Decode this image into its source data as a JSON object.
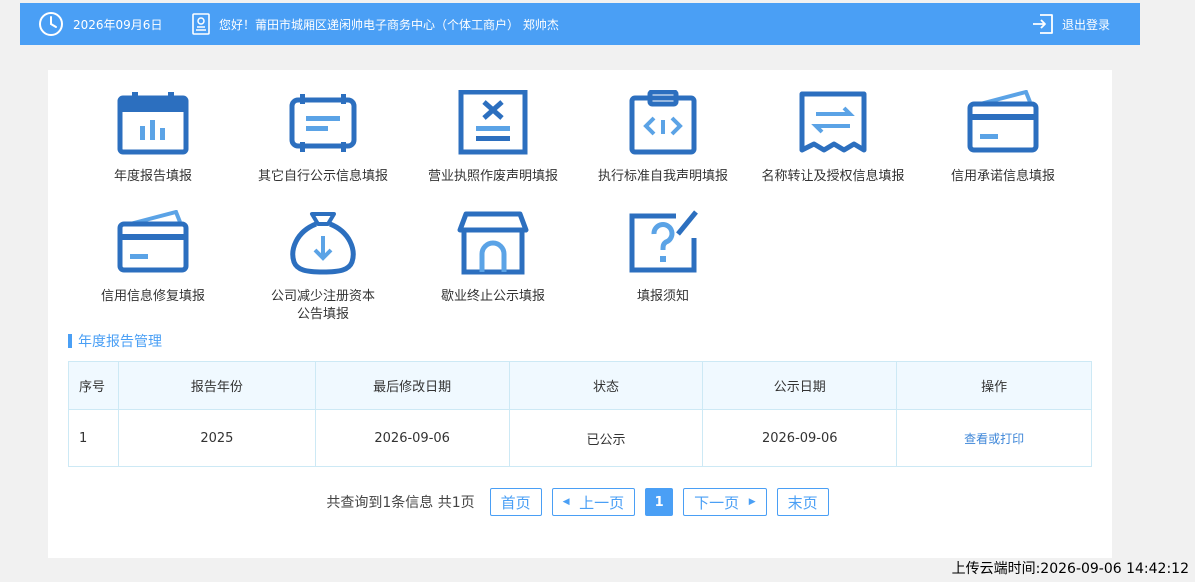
{
  "header": {
    "date": "2026年09月6日",
    "welcome": "您好！莆田市城厢区递闲帅电子商务中心（个体工商户） 郑帅杰",
    "logout": "退出登录"
  },
  "tiles": [
    {
      "label": "年度报告填报",
      "icon": "calendar-chart-icon"
    },
    {
      "label": "其它自行公示信息填报",
      "icon": "signboard-icon"
    },
    {
      "label": "营业执照作废声明填报",
      "icon": "license-void-icon"
    },
    {
      "label": "执行标准自我声明填报",
      "icon": "clipboard-code-icon"
    },
    {
      "label": "名称转让及授权信息填报",
      "icon": "transfer-receipt-icon"
    },
    {
      "label": "信用承诺信息填报",
      "icon": "credit-card-icon"
    },
    {
      "label": "信用信息修复填报",
      "icon": "credit-card-icon"
    },
    {
      "label": "公司减少注册资本",
      "label2": "公告填报",
      "icon": "money-bag-down-icon"
    },
    {
      "label": "歇业终止公示填报",
      "icon": "store-icon"
    },
    {
      "label": "填报须知",
      "icon": "question-edit-icon"
    }
  ],
  "section": {
    "title": "年度报告管理"
  },
  "table": {
    "headers": [
      "序号",
      "报告年份",
      "最后修改日期",
      "状态",
      "公示日期",
      "操作"
    ],
    "rows": [
      {
        "seq": "1",
        "year": "2025",
        "modified": "2026-09-06",
        "status": "已公示",
        "published": "2026-09-06",
        "action": "查看或打印"
      }
    ]
  },
  "pager": {
    "summary": "共查询到1条信息 共1页",
    "first": "首页",
    "prev": "上一页",
    "current": "1",
    "next": "下一页",
    "last": "末页"
  },
  "footer": {
    "upload_time": "上传云端时间:2026-09-06 14:42:12"
  },
  "colors": {
    "accent": "#4a9ff5",
    "icon": "#2c6fbf",
    "link": "#3d86d8"
  }
}
